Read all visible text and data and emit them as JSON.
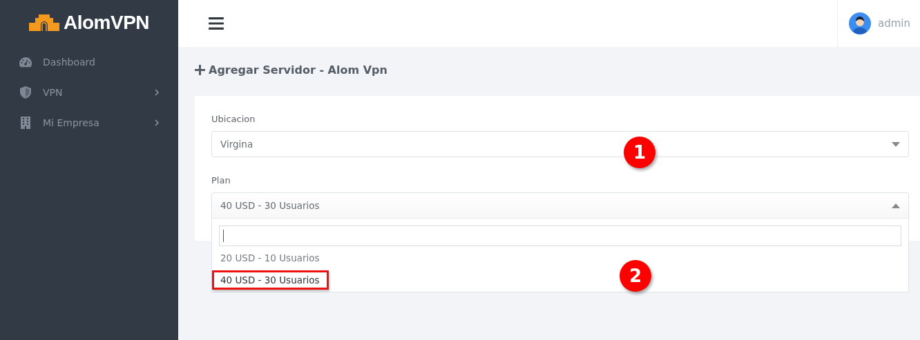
{
  "brand": "AlomVPN",
  "sidebar": {
    "items": [
      {
        "label": "Dashboard",
        "kind": "gauge",
        "expandable": false
      },
      {
        "label": "VPN",
        "kind": "shield",
        "expandable": true
      },
      {
        "label": "Mi Empresa",
        "kind": "building",
        "expandable": true
      }
    ]
  },
  "user": {
    "name": "admin"
  },
  "page_title": "Agregar Servidor - Alom Vpn",
  "form": {
    "fields": [
      {
        "label": "Ubicacion",
        "value": "Virgina",
        "open": false
      },
      {
        "label": "Plan",
        "value": "40 USD - 30 Usuarios",
        "open": true,
        "options": [
          {
            "label": "20 USD - 10 Usuarios",
            "selected": false
          },
          {
            "label": "40 USD - 30 Usuarios",
            "selected": true
          }
        ]
      }
    ]
  },
  "callouts": [
    "1",
    "2"
  ]
}
